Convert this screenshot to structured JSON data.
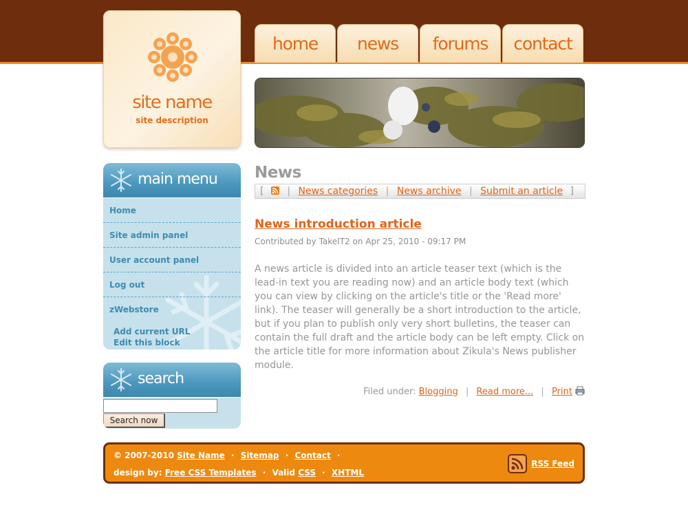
{
  "brand": {
    "site_name": "site name",
    "site_description": "site description",
    "logo_icon": "flower-logo-icon",
    "colors": {
      "header_brown": "#6e2d0c",
      "accent_orange": "#e0641a",
      "menu_blue": "#3d8bb1",
      "footer_orange": "#ee890f"
    }
  },
  "nav_tabs": [
    "home",
    "news",
    "forums",
    "contact"
  ],
  "main_menu": {
    "title": "main menu",
    "items": [
      "Home",
      "Site admin panel",
      "User account panel",
      "Log out",
      "zWebstore"
    ],
    "sub_items": [
      "Add current URL",
      "Edit this block"
    ]
  },
  "search": {
    "title": "search",
    "input_value": "",
    "button_label": "Search now"
  },
  "content": {
    "section_title": "News",
    "nav": {
      "open_bracket": "[",
      "rss_icon": "rss-icon",
      "links": [
        "News categories",
        "News archive",
        "Submit an article"
      ],
      "close_bracket": "]"
    },
    "article": {
      "title": "News introduction article",
      "meta": "Contributed by TakeIT2 on Apr 25, 2010 - 09:17 PM",
      "body": "A news article is divided into an article teaser text (which is the lead-in text you are reading now) and an article body text (which you can view by clicking on the article's title or the 'Read more' link). The teaser will generally be a short introduction to the article, but if you plan to publish only very short bulletins, the teaser can contain the full draft and the article body can be left empty. Click on the article title for more information about Zikula's News publisher module.",
      "filed_under_label": "Filed under:",
      "category": "Blogging",
      "read_more": "Read more...",
      "print": "Print",
      "print_icon": "printer-icon"
    }
  },
  "footer": {
    "copyright": "© 2007-2010",
    "site_name_link": "Site Name",
    "sitemap": "Sitemap",
    "contact": "Contact",
    "design_by": "design by:",
    "design_link": "Free CSS Templates",
    "valid": "Valid",
    "css": "CSS",
    "xhtml": "XHTML",
    "rss_feed": "RSS Feed",
    "rss_icon": "rss-feed-icon"
  }
}
